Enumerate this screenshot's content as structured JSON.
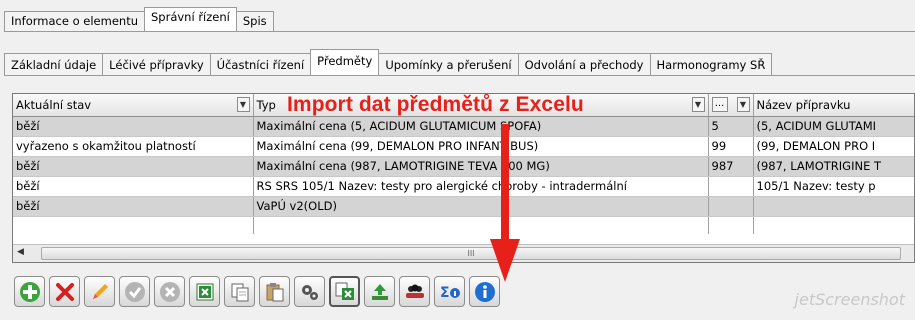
{
  "tabs_top": [
    {
      "label": "Informace o elementu",
      "active": false
    },
    {
      "label": "Správní řízení",
      "active": true
    },
    {
      "label": "Spis",
      "active": false
    }
  ],
  "tabs_sub": [
    {
      "label": "Základní údaje",
      "active": false
    },
    {
      "label": "Léčivé přípravky",
      "active": false
    },
    {
      "label": "Účastníci řízení",
      "active": false
    },
    {
      "label": "Předměty",
      "active": true
    },
    {
      "label": "Upomínky a přerušení",
      "active": false
    },
    {
      "label": "Odvolání a přechody",
      "active": false
    },
    {
      "label": "Harmonogramy SŘ",
      "active": false
    }
  ],
  "grid": {
    "columns": [
      "Aktuální stav",
      "Typ",
      "",
      "Název přípravku"
    ],
    "dots_label": "...",
    "rows": [
      {
        "stav": "běží",
        "typ": "Maximální cena (5, ACIDUM GLUTAMICUM SPOFA)",
        "kod": "5",
        "nazev": "(5, ACIDUM GLUTAMI",
        "style": "grey"
      },
      {
        "stav": "vyřazeno s okamžitou platností",
        "typ": "Maximální cena (99, DEMALON PRO INFANTIBUS)",
        "kod": "99",
        "nazev": "(99, DEMALON PRO I",
        "style": "white"
      },
      {
        "stav": "běží",
        "typ": "Maximální cena (987, LAMOTRIGINE TEVA 100 MG)",
        "kod": "987",
        "nazev": "(987, LAMOTRIGINE T",
        "style": "grey"
      },
      {
        "stav": "běží",
        "typ": "RS SRS 105/1 Nazev: testy pro alergické choroby - intradermální",
        "kod": "",
        "nazev": "105/1 Nazev: testy p",
        "style": "white"
      },
      {
        "stav": "běží",
        "typ": "VaPÚ v2(OLD)",
        "kod": "",
        "nazev": "",
        "style": "grey"
      }
    ],
    "scroll_grip": "III"
  },
  "annotation": "Import dat předmětů z Excelu",
  "toolbar": [
    {
      "name": "add-button",
      "icon": "plus-icon",
      "enabled": true
    },
    {
      "name": "delete-button",
      "icon": "cross-icon",
      "enabled": true
    },
    {
      "name": "edit-button",
      "icon": "pencil-icon",
      "enabled": true
    },
    {
      "name": "confirm-button",
      "icon": "check-icon",
      "enabled": false
    },
    {
      "name": "cancel-button",
      "icon": "cancel-icon",
      "enabled": false
    },
    {
      "name": "excel-export-button",
      "icon": "excel-icon",
      "enabled": true
    },
    {
      "name": "copy-button",
      "icon": "copy-icon",
      "enabled": true
    },
    {
      "name": "paste-button",
      "icon": "paste-icon",
      "enabled": true
    },
    {
      "name": "settings-button",
      "icon": "gears-icon",
      "enabled": true
    },
    {
      "name": "excel-import-button",
      "icon": "excel-import-icon",
      "enabled": true,
      "selected": true
    },
    {
      "name": "upload-button",
      "icon": "upload-icon",
      "enabled": true
    },
    {
      "name": "group-button",
      "icon": "people-icon",
      "enabled": true
    },
    {
      "name": "sum-info-button",
      "icon": "sigma-icon",
      "enabled": true
    },
    {
      "name": "info-button",
      "icon": "info-icon",
      "enabled": true
    }
  ],
  "colors": {
    "annotation": "#e8201a",
    "row_grey": "#d4d4d4"
  },
  "watermark": "jetScreenshot"
}
